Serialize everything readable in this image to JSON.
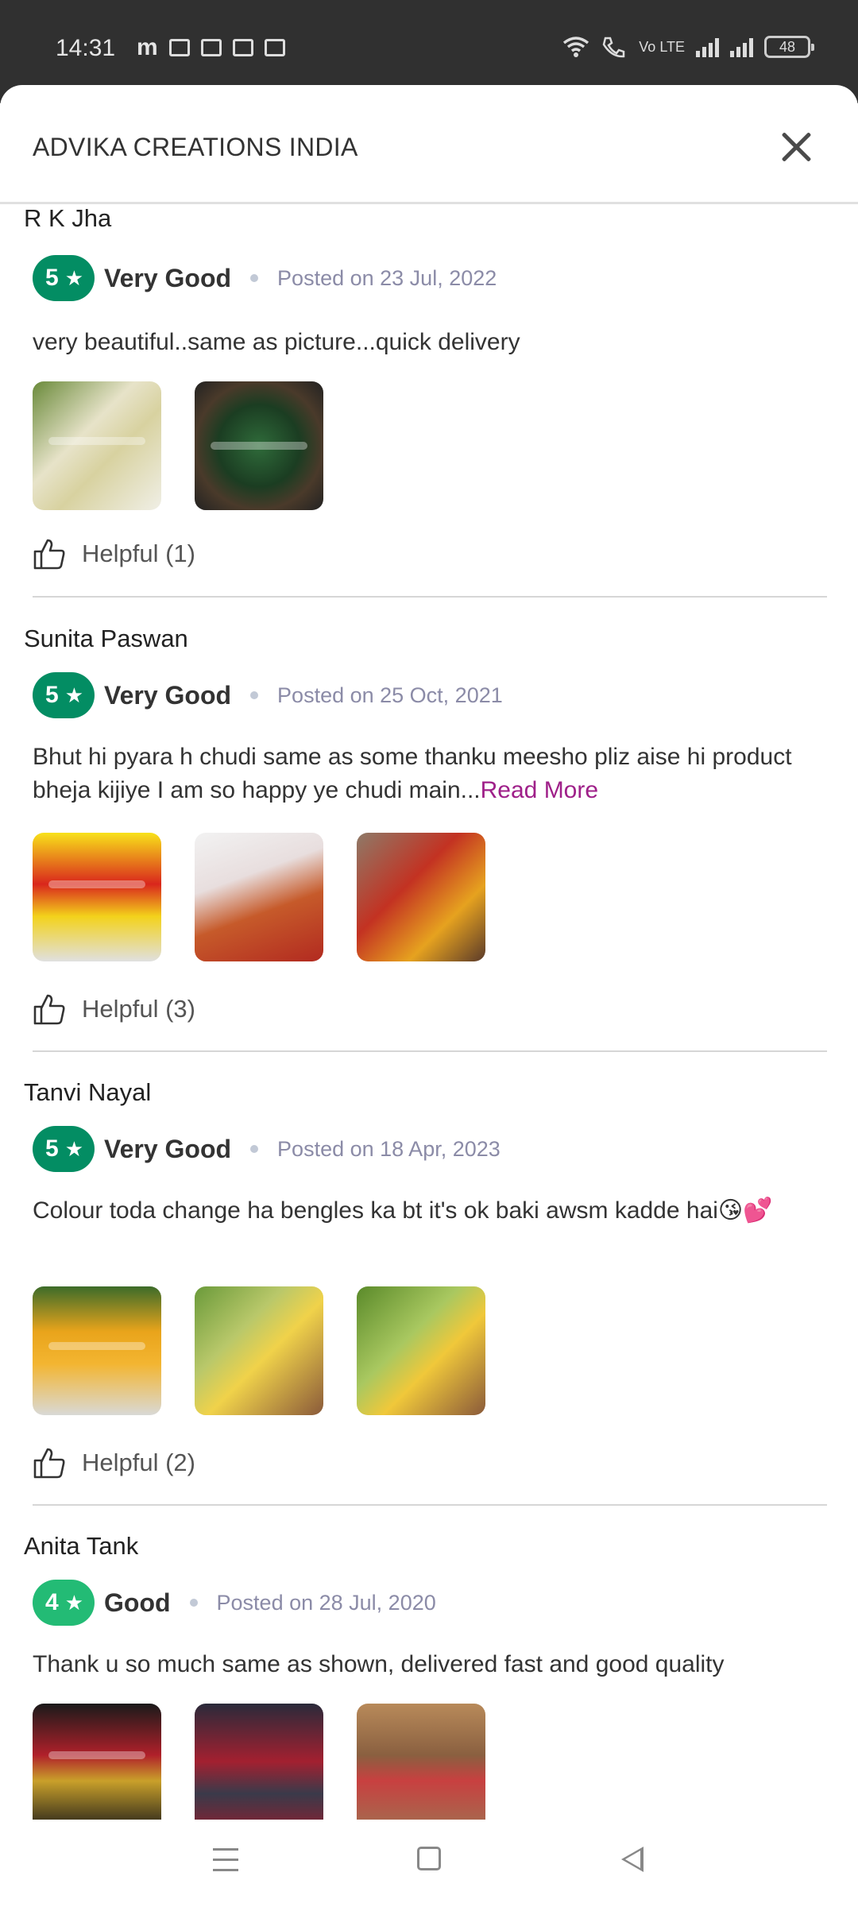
{
  "status_bar": {
    "time": "14:31",
    "left_icon_letter": "m",
    "network_label": "Vo LTE",
    "battery": "48"
  },
  "sheet": {
    "title": "ADVIKA CREATIONS INDIA"
  },
  "reviews": [
    {
      "name": "R K Jha",
      "rating": "5",
      "rating_label": "Very Good",
      "posted": "Posted on 23 Jul, 2022",
      "text": "very beautiful..same as picture...quick delivery",
      "read_more": "",
      "helpful": "Helpful (1)"
    },
    {
      "name": "Sunita Paswan",
      "rating": "5",
      "rating_label": "Very Good",
      "posted": "Posted on 25 Oct, 2021",
      "text": "Bhut hi pyara h chudi same as some thanku meesho pliz aise hi product bheja kijiye I am so happy ye chudi main...",
      "read_more": "Read More",
      "helpful": "Helpful (3)"
    },
    {
      "name": "Tanvi Nayal",
      "rating": "5",
      "rating_label": "Very Good",
      "posted": "Posted on 18 Apr, 2023",
      "text": "Colour toda change ha bengles ka bt it's ok baki awsm kadde hai😘💕",
      "read_more": "",
      "helpful": "Helpful (2)"
    },
    {
      "name": "Anita Tank",
      "rating": "4",
      "rating_label": "Good",
      "posted": "Posted on 28 Jul, 2020",
      "text": "Thank u so much same as shown, delivered fast and good quality",
      "read_more": "",
      "helpful": ""
    }
  ],
  "colors": {
    "rating_dark_green": "#038d63",
    "rating_light_green": "#23bb75",
    "read_more": "#9f2089"
  }
}
